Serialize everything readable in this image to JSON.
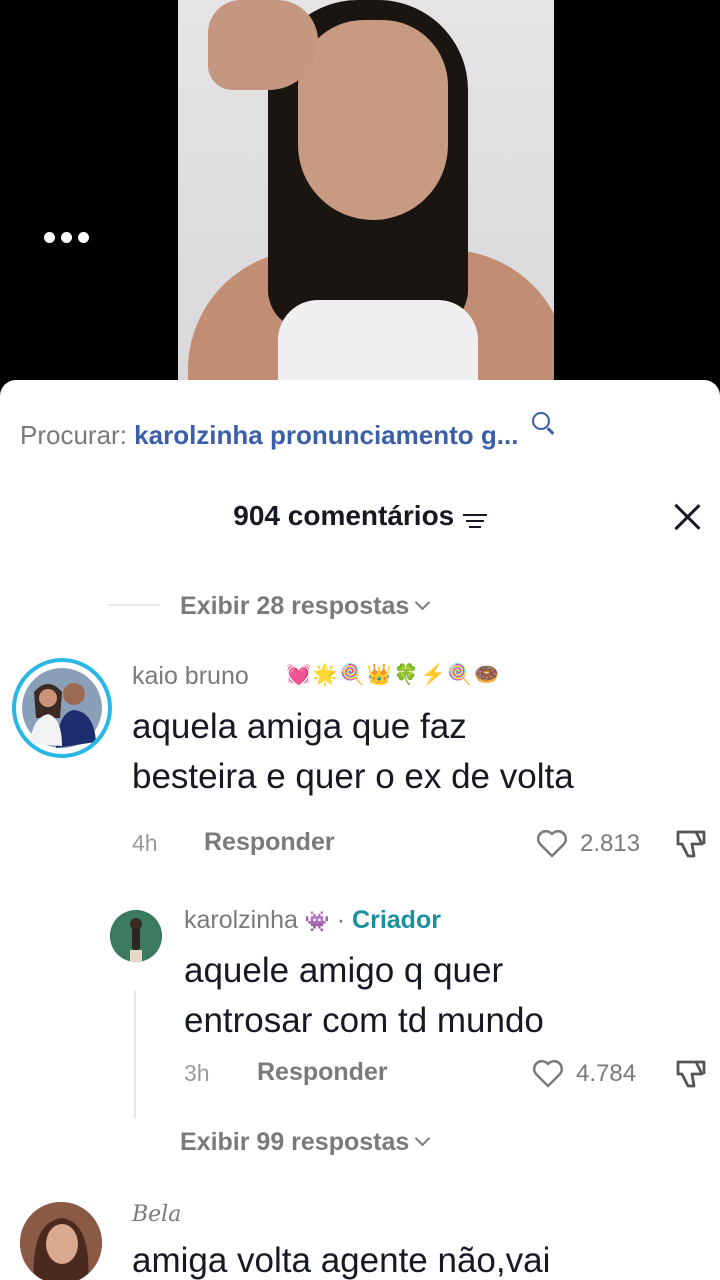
{
  "search": {
    "prefix": "Procurar:",
    "query": "karolzinha pronunciamento g..."
  },
  "header": {
    "count_label": "904 comentários"
  },
  "view_replies_1": "Exibir 28 respostas",
  "comments": [
    {
      "username": "kaio bruno",
      "emojis": "💓🌟🍭👑🍀⚡🍭🍩",
      "text_line1": "aquela amiga que faz",
      "text_line2": "besteira e quer o ex de volta",
      "time": "4h",
      "reply_label": "Responder",
      "likes": "2.813"
    }
  ],
  "reply": {
    "username": "karolzinha",
    "emoji": "👾",
    "separator": "·",
    "creator_label": "Criador",
    "text_line1": "aquele amigo q quer",
    "text_line2": "entrosar com td mundo",
    "time": "3h",
    "reply_label": "Responder",
    "likes": "4.784"
  },
  "view_replies_2": "Exibir 99 respostas",
  "comment3": {
    "username": "Bela",
    "text_line1": "amiga volta agente não,vai"
  },
  "colors": {
    "link_blue": "#3a5fa8",
    "creator_teal": "#1a8fa0",
    "story_ring": "#2bb7e6"
  },
  "icons": [
    "more-dots-icon",
    "search-icon",
    "filter-icon",
    "close-icon",
    "heart-icon",
    "dislike-icon",
    "chevron-down-icon"
  ]
}
